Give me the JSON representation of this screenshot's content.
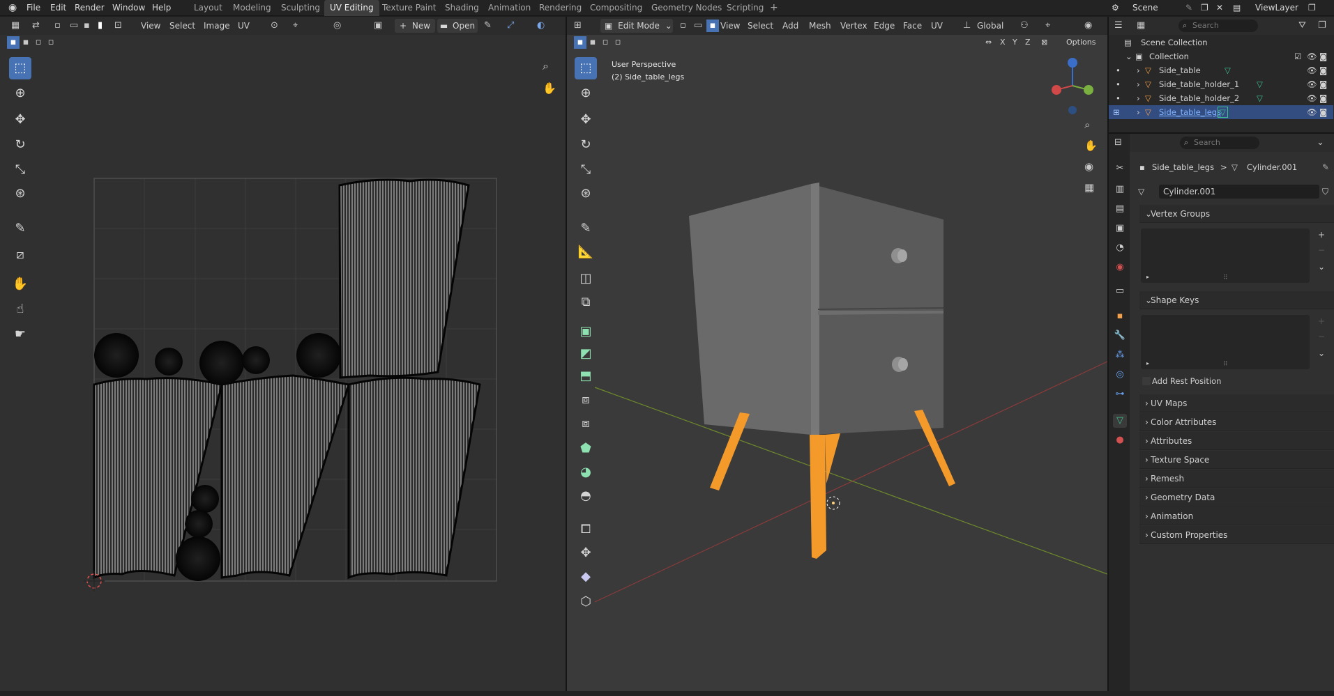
{
  "topbar": {
    "menu": [
      "File",
      "Edit",
      "Render",
      "Window",
      "Help"
    ],
    "workspaces": [
      "Layout",
      "Modeling",
      "Sculpting",
      "UV Editing",
      "Texture Paint",
      "Shading",
      "Animation",
      "Rendering",
      "Compositing",
      "Geometry Nodes",
      "Scripting"
    ],
    "active_workspace": "UV Editing",
    "add_tab": "+",
    "scene_label": "Scene",
    "viewlayer_label": "ViewLayer"
  },
  "uv_editor": {
    "header": {
      "view": "View",
      "select": "Select",
      "image": "Image",
      "uv": "UV",
      "new": "New",
      "open": "Open",
      "new_plus": "+"
    },
    "tools": [
      "select-box",
      "cursor",
      "move",
      "rotate",
      "scale",
      "transform",
      "annotate",
      "rip",
      "grab",
      "relax",
      "pinch"
    ]
  },
  "viewport": {
    "header": {
      "mode": "Edit Mode",
      "view": "View",
      "select": "Select",
      "add": "Add",
      "mesh": "Mesh",
      "vertex": "Vertex",
      "edge": "Edge",
      "face": "Face",
      "uv": "UV",
      "orientation": "Global",
      "options": "Options",
      "x": "X",
      "y": "Y",
      "z": "Z"
    },
    "overlay_line1": "User Perspective",
    "overlay_line2": "(2) Side_table_legs",
    "colors": {
      "floor_x": "#9a3a3a",
      "floor_y": "#6e8a2c",
      "legs": "#f39a2b",
      "body": "#6b6b6b"
    }
  },
  "outliner": {
    "search_placeholder": "Search",
    "scene_collection": "Scene Collection",
    "collection": "Collection",
    "items": [
      {
        "name": "Side_table",
        "selected": false
      },
      {
        "name": "Side_table_holder_1",
        "selected": false
      },
      {
        "name": "Side_table_holder_2",
        "selected": false
      },
      {
        "name": "Side_table_legs",
        "selected": true
      }
    ]
  },
  "properties": {
    "search_placeholder": "Search",
    "breadcrumb_object": "Side_table_legs",
    "breadcrumb_arrow": ">",
    "breadcrumb_data": "Cylinder.001",
    "mesh_name": "Cylinder.001",
    "vertex_groups": "Vertex Groups",
    "shape_keys": "Shape Keys",
    "add_rest_position": "Add Rest Position",
    "panels": [
      "UV Maps",
      "Color Attributes",
      "Attributes",
      "Texture Space",
      "Remesh",
      "Geometry Data",
      "Animation",
      "Custom Properties"
    ]
  }
}
